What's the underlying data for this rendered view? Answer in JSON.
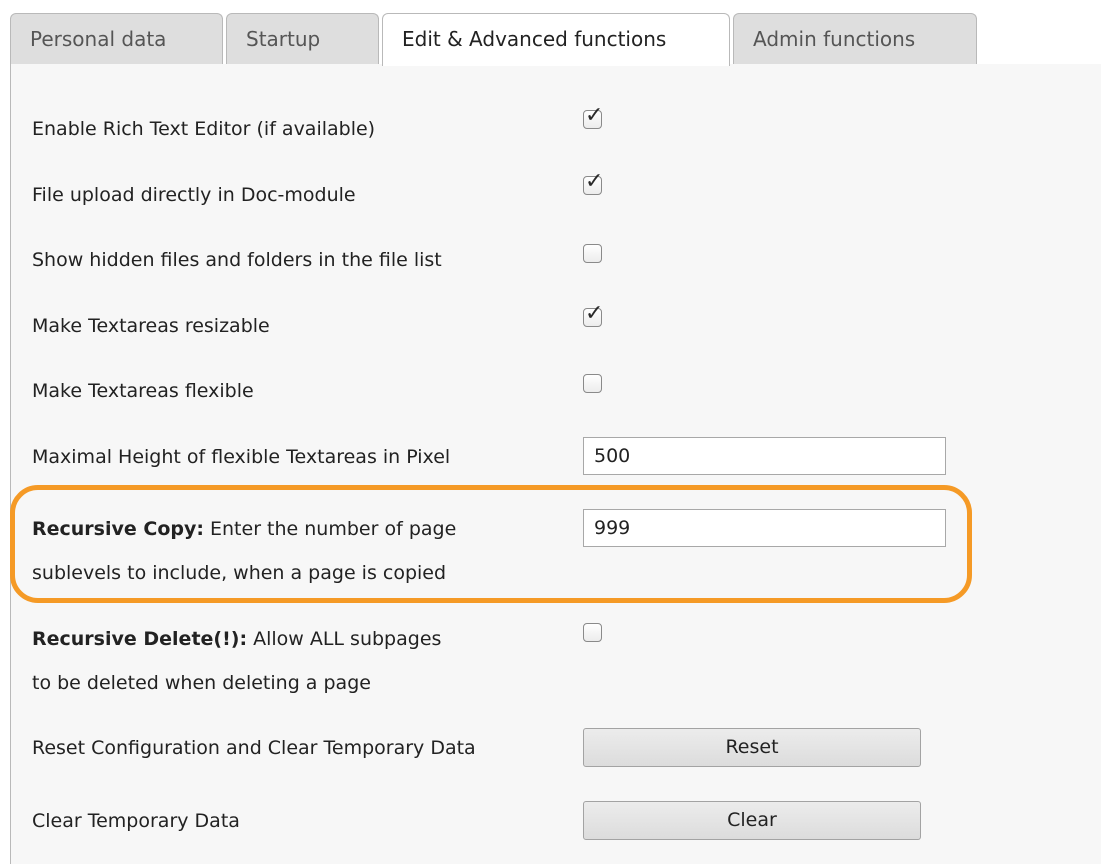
{
  "tabs": [
    {
      "label": "Personal data",
      "active": false
    },
    {
      "label": "Startup",
      "active": false
    },
    {
      "label": "Edit & Advanced functions",
      "active": true
    },
    {
      "label": "Admin functions",
      "active": false
    }
  ],
  "settings": {
    "rich_text": {
      "label": "Enable Rich Text Editor (if available)",
      "checked": true
    },
    "file_upload": {
      "label": "File upload directly in Doc-module",
      "checked": true
    },
    "hidden_files": {
      "label": "Show hidden files and folders in the file list",
      "checked": false
    },
    "textarea_resizable": {
      "label": "Make Textareas resizable",
      "checked": true
    },
    "textarea_flexible": {
      "label": "Make Textareas flexible",
      "checked": false
    },
    "max_height": {
      "label": "Maximal Height of flexible Textareas in Pixel",
      "value": "500"
    },
    "recursive_copy": {
      "label_bold": "Recursive Copy:",
      "label_line1": " Enter the number of page",
      "label_line2": "sublevels to include, when a page is copied",
      "value": "999"
    },
    "recursive_delete": {
      "label_bold": "Recursive Delete(!):",
      "label_line1": " Allow ALL subpages",
      "label_line2": "to be deleted when deleting a page",
      "checked": false
    },
    "reset": {
      "label": "Reset Configuration and Clear Temporary Data",
      "button": "Reset"
    },
    "clear": {
      "label": "Clear Temporary Data",
      "button": "Clear"
    }
  },
  "colors": {
    "highlight": "#f59a26",
    "panel_bg": "#f7f7f7",
    "tab_bg": "#dedede"
  }
}
